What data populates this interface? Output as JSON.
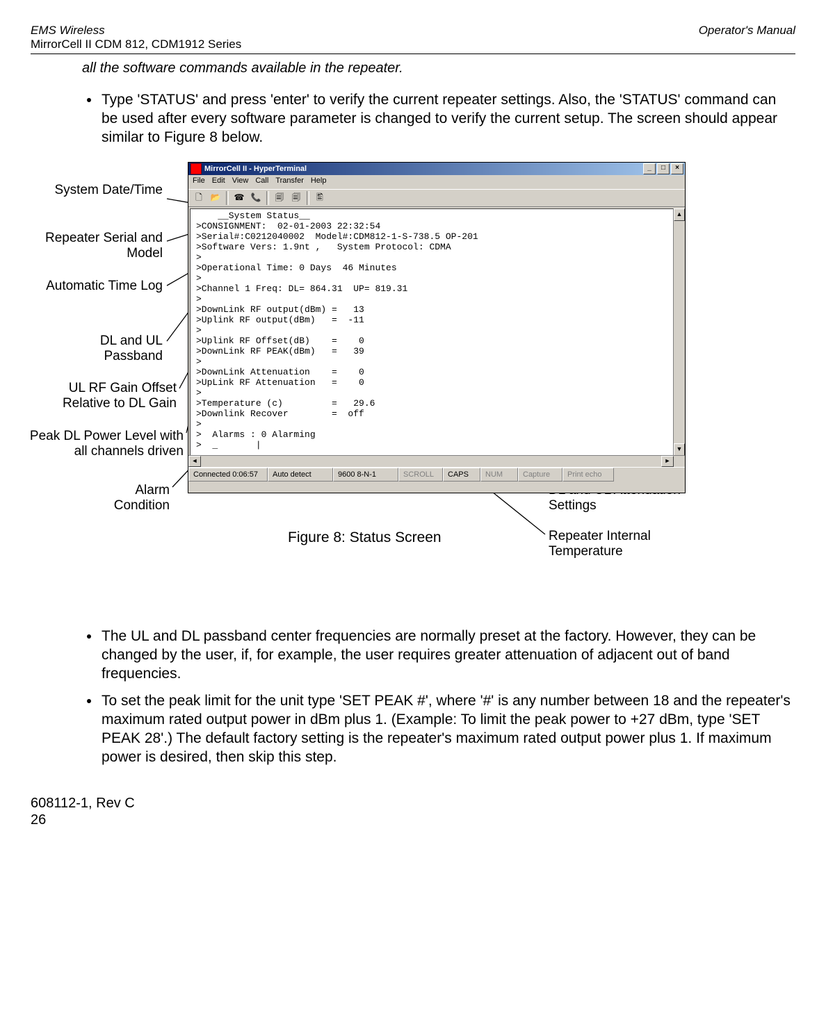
{
  "header": {
    "brand": "EMS Wireless",
    "series": "MirrorCell II CDM 812, CDM1912 Series",
    "doc_type": "Operator's Manual"
  },
  "continuation": "all the software commands available in the repeater.",
  "bullet_top": "Type 'STATUS' and press 'enter' to verify the current repeater settings.  Also, the 'STATUS' command can be used after every software parameter is changed to verify the current setup.  The screen should appear similar to Figure 8 below.",
  "callouts": {
    "system_date_time": "System Date/Time",
    "repeater_serial_model": "Repeater Serial and Model",
    "automatic_time_log": "Automatic Time Log",
    "dl_ul_passband": "DL and UL Passband",
    "ul_rf_gain_offset": "UL RF Gain Offset Relative to DL Gain",
    "peak_dl_power": "Peak DL Power Level with all channels driven",
    "alarm_condition": "Alarm Condition",
    "dl_ul_atten": "DL and UL Attenuation Settings",
    "repeater_temp": "Repeater Internal Temperature"
  },
  "figure_caption": "Figure 8:  Status Screen",
  "hyperterminal": {
    "title": "MirrorCell II - HyperTerminal",
    "menus": [
      "File",
      "Edit",
      "View",
      "Call",
      "Transfer",
      "Help"
    ],
    "lines": [
      "    __System Status__",
      ">CONSIGNMENT:  02-01-2003 22:32:54",
      ">Serial#:C0212040002  Model#:CDM812-1-S-738.5 OP-201",
      ">Software Vers: 1.9nt ,   System Protocol: CDMA",
      ">",
      ">Operational Time: 0 Days  46 Minutes",
      ">",
      ">Channel 1 Freq: DL= 864.31  UP= 819.31",
      ">",
      ">DownLink RF output(dBm) =   13",
      ">Uplink RF output(dBm)   =  -11",
      ">",
      ">Uplink RF Offset(dB)    =    0",
      ">DownLink RF PEAK(dBm)   =   39",
      ">",
      ">DownLink Attenuation    =    0",
      ">UpLink RF Attenuation   =    0",
      ">",
      ">Temperature (c)         =   29.6",
      ">Downlink Recover        =  off",
      ">",
      ">  Alarms : 0 Alarming",
      ">  _       |"
    ],
    "status_bar": [
      "Connected 0:06:57",
      "Auto detect",
      "9600 8-N-1",
      "SCROLL",
      "CAPS",
      "NUM",
      "Capture",
      "Print echo"
    ]
  },
  "bullets_bottom": [
    "The UL and DL passband center frequencies are normally preset at the factory.  However, they can be changed by the user, if, for example, the user requires greater attenuation of adjacent out of band frequencies.",
    "To set the peak limit for the unit type 'SET PEAK #', where '#' is any number between 18 and the repeater's maximum rated output power in dBm plus 1.  (Example:  To limit the peak power to +27 dBm, type 'SET PEAK 28'.)  The default factory setting is the repeater's maximum rated output power plus 1.  If maximum power is desired, then skip this step."
  ],
  "footer": {
    "docnum": "608112-1, Rev C",
    "page": "26"
  }
}
